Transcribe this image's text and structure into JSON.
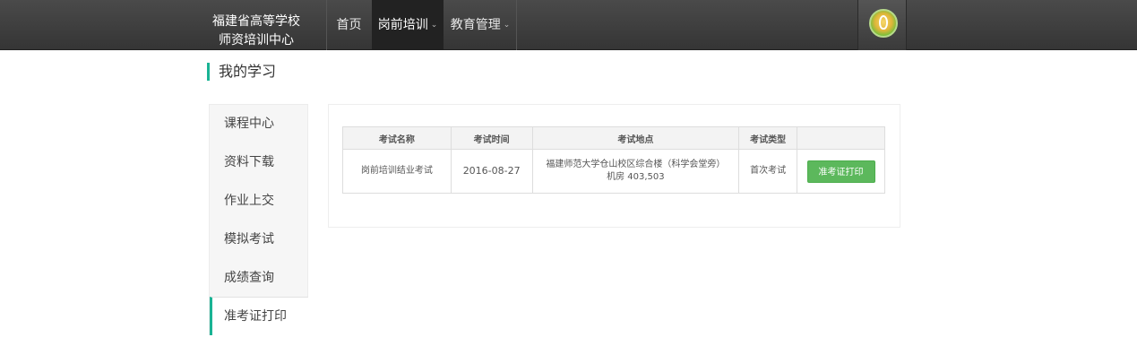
{
  "brand": {
    "line1": "福建省高等学校",
    "line2": "师资培训中心"
  },
  "nav": {
    "home": "首页",
    "training": "岗前培训",
    "education": "教育管理",
    "caret": "⌄"
  },
  "page": {
    "title": "我的学习"
  },
  "sidebar": {
    "items": [
      {
        "label": "课程中心"
      },
      {
        "label": "资料下载"
      },
      {
        "label": "作业上交"
      },
      {
        "label": "模拟考试"
      },
      {
        "label": "成绩查询"
      },
      {
        "label": "准考证打印"
      }
    ]
  },
  "exam_table": {
    "headers": [
      "考试名称",
      "考试时间",
      "考试地点",
      "考试类型",
      ""
    ],
    "rows": [
      {
        "name": "岗前培训结业考试",
        "date": "2016-08-27",
        "location_line1": "福建师范大学仓山校区综合楼（科学会堂旁）",
        "location_line2": "机房 403,503",
        "type": "首次考试",
        "action": "准考证打印"
      }
    ]
  },
  "colors": {
    "accent": "#1ab394",
    "button": "#5cb85c",
    "navbar": "#3c3c3c"
  }
}
